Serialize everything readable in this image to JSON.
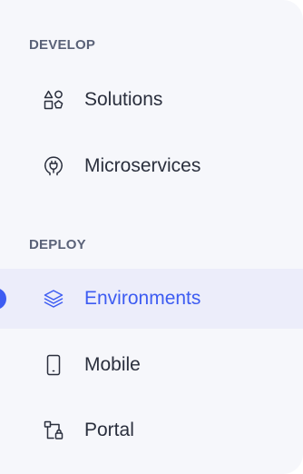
{
  "sidebar": {
    "sections": [
      {
        "header": "DEVELOP",
        "items": [
          {
            "label": "Solutions",
            "icon": "shapes-icon",
            "active": false
          },
          {
            "label": "Microservices",
            "icon": "plug-icon",
            "active": false
          }
        ]
      },
      {
        "header": "DEPLOY",
        "items": [
          {
            "label": "Environments",
            "icon": "layers-icon",
            "active": true
          },
          {
            "label": "Mobile",
            "icon": "mobile-device-icon",
            "active": false
          },
          {
            "label": "Portal",
            "icon": "portal-icon",
            "active": false
          }
        ]
      }
    ],
    "colors": {
      "background": "#f6f7fb",
      "active_background": "#ecedfa",
      "accent": "#3d5cf2",
      "text": "#2a2f3d",
      "header_text": "#5a6278"
    }
  }
}
